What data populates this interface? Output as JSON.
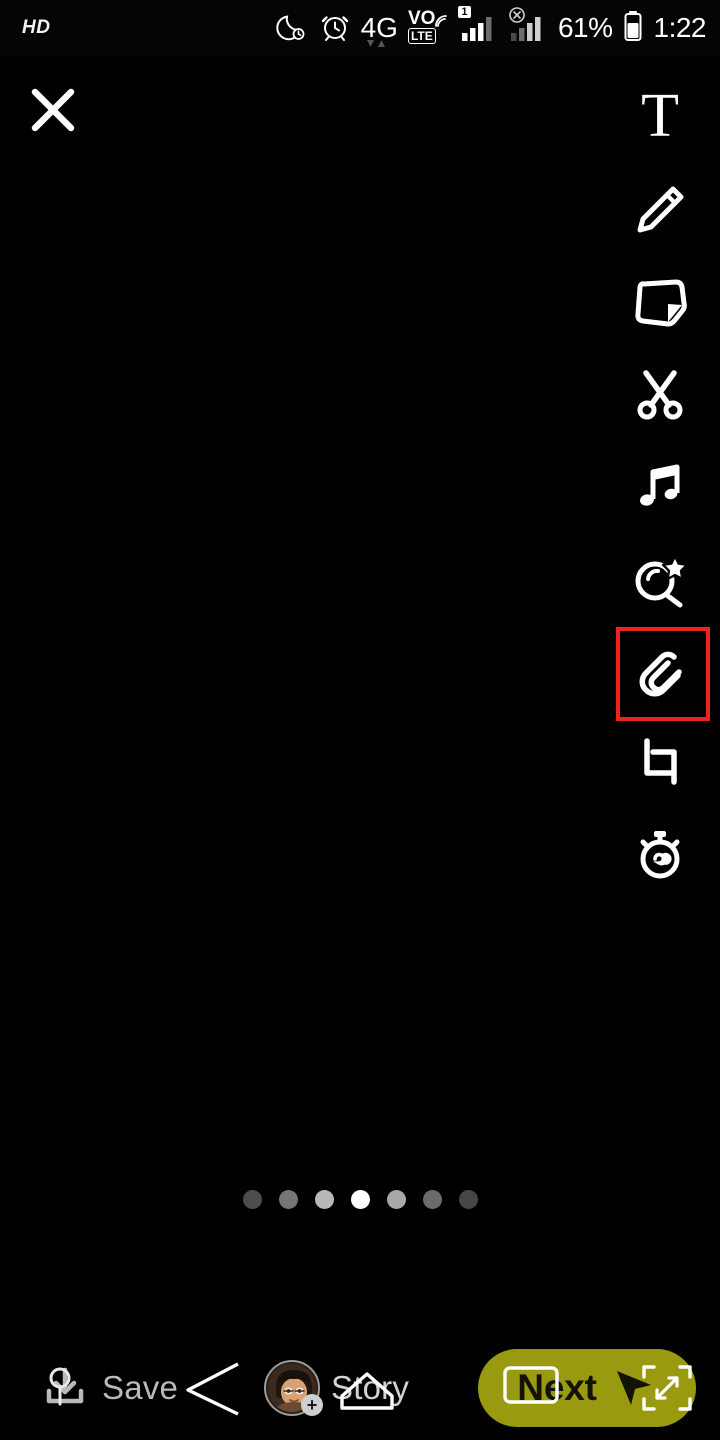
{
  "status_bar": {
    "hd_label": "HD",
    "network_type": "4G",
    "volte_label_top": "VO",
    "volte_label_bottom": "LTE",
    "sim1_badge": "1",
    "battery_percent": "61%",
    "time": "1:22",
    "icons": [
      {
        "name": "do-not-disturb-moon-icon"
      },
      {
        "name": "alarm-clock-icon"
      },
      {
        "name": "network-4g-icon"
      },
      {
        "name": "volte-icon"
      },
      {
        "name": "signal-bars-sim1-icon"
      },
      {
        "name": "signal-bars-no-service-icon"
      },
      {
        "name": "battery-icon"
      }
    ]
  },
  "close_button": {
    "name": "close-icon",
    "label": "Close"
  },
  "tool_rail": {
    "items": [
      {
        "id": "text",
        "name": "text-tool-button",
        "label": "T",
        "icon": "text-icon",
        "highlighted": false
      },
      {
        "id": "draw",
        "name": "draw-tool-button",
        "label": "Draw",
        "icon": "pencil-icon",
        "highlighted": false
      },
      {
        "id": "sticker",
        "name": "sticker-tool-button",
        "label": "Stickers",
        "icon": "sticker-icon",
        "highlighted": false
      },
      {
        "id": "scissors",
        "name": "scissors-tool-button",
        "label": "Scissors",
        "icon": "scissors-icon",
        "highlighted": false
      },
      {
        "id": "music",
        "name": "music-tool-button",
        "label": "Music",
        "icon": "music-note-icon",
        "highlighted": false
      },
      {
        "id": "scan",
        "name": "scan-tool-button",
        "label": "Scan",
        "icon": "scan-star-icon",
        "highlighted": false
      },
      {
        "id": "attach",
        "name": "attach-link-button",
        "label": "Attachment",
        "icon": "paperclip-icon",
        "highlighted": true
      },
      {
        "id": "crop",
        "name": "crop-tool-button",
        "label": "Crop",
        "icon": "crop-icon",
        "highlighted": false
      },
      {
        "id": "timer",
        "name": "timer-tool-button",
        "label": "Timer",
        "icon": "stopwatch-infinity-icon",
        "highlighted": false
      }
    ],
    "highlight_color": "#ef2222"
  },
  "pagination": {
    "total": 7,
    "active_index": 3,
    "dot_opacities": [
      0.3,
      0.46,
      0.72,
      1.0,
      0.66,
      0.42,
      0.28
    ]
  },
  "bottom_bar": {
    "save": {
      "label": "Save",
      "icon": "download-save-icon"
    },
    "story": {
      "label": "Story",
      "icon": "story-avatar-icon",
      "badge": "+"
    },
    "next": {
      "label": "Next",
      "icon": "send-arrow-icon",
      "color": "#9a9a11"
    }
  },
  "nav_overlay": {
    "back": {
      "name": "android-back-icon"
    },
    "home": {
      "name": "android-home-icon"
    },
    "recents": {
      "name": "android-recents-icon"
    },
    "expand": {
      "name": "android-expand-icon"
    },
    "home_pill": {
      "name": "android-home-pill-icon"
    }
  }
}
